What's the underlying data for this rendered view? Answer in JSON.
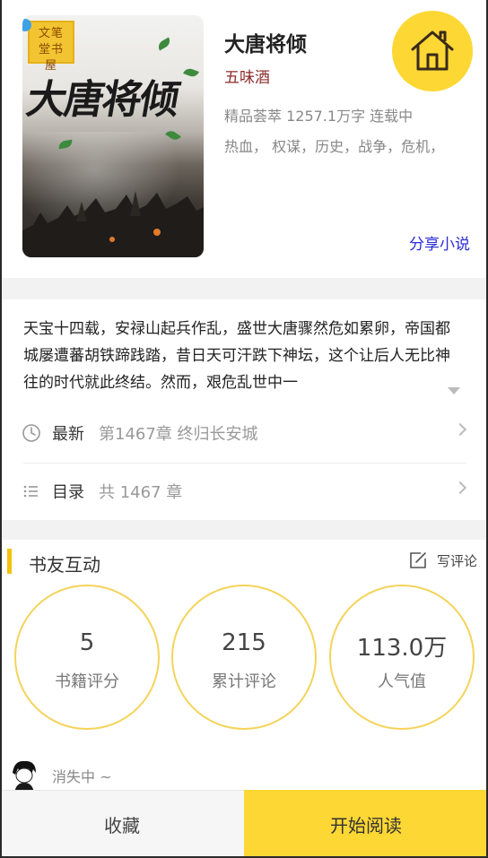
{
  "book": {
    "title": "大唐将倾",
    "author": "五味酒",
    "meta": "精品荟萃 1257.1万字 连载中",
    "tags": "热血， 权谋，历史，战争，危机，",
    "share_label": "分享小说",
    "cover": {
      "title_text": "大唐将倾",
      "seal_text": "文笔堂书屋"
    }
  },
  "description": "天宝十四载，安禄山起兵作乱，盛世大唐骤然危如累卵，帝国都城屡遭蕃胡铁蹄践踏，昔日天可汗跌下神坛，这个让后人无比神往的时代就此终结。然而，艰危乱世中一",
  "latest": {
    "label": "最新",
    "value": "第1467章 终归长安城"
  },
  "catalog": {
    "label": "目录",
    "value": "共 1467 章"
  },
  "interaction": {
    "title": "书友互动",
    "write_review": "写评论",
    "stats": [
      {
        "value": "5",
        "label": "书籍评分"
      },
      {
        "value": "215",
        "label": "累计评论"
      },
      {
        "value": "113.0万",
        "label": "人气值"
      }
    ]
  },
  "commenter": {
    "name": "消失中 ~"
  },
  "actions": {
    "collect": "收藏",
    "read": "开始阅读"
  },
  "colors": {
    "accent": "#fdd734",
    "link": "#2b2bd8",
    "author": "#8b2a2a"
  },
  "icons": [
    "home-icon",
    "clock-icon",
    "list-icon",
    "chevron-right-icon",
    "edit-icon",
    "expand-arrow-icon"
  ]
}
